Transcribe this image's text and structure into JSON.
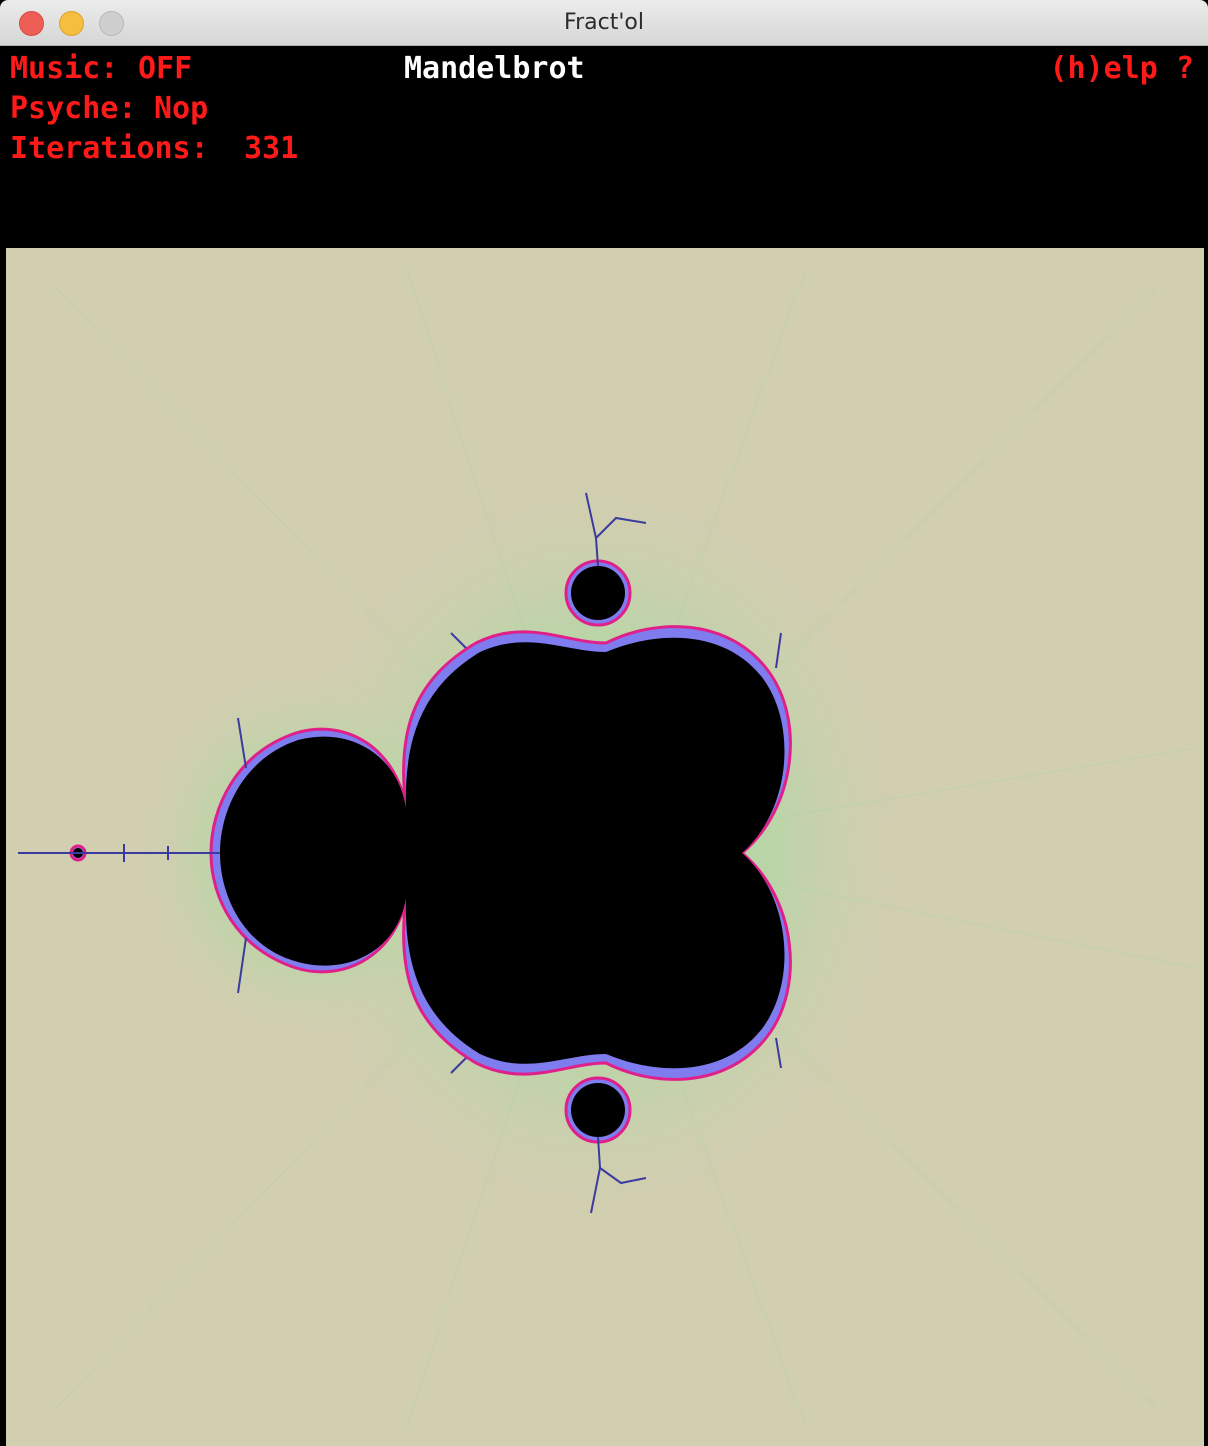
{
  "window": {
    "title": "Fract'ol"
  },
  "hud": {
    "music_label": "Music:",
    "music_value": "OFF",
    "psyche_label": "Psyche:",
    "psyche_value": "Nop",
    "iterations_label": "Iterations:",
    "iterations_value": "331",
    "fractal_name": "Mandelbrot",
    "help": "(h)elp ?"
  },
  "render": {
    "fractal": "Mandelbrot",
    "iterations": 331,
    "colors": {
      "background": "#d2ceb0",
      "set": "#000000",
      "halo_green": "#8fdc9a",
      "edge_blue": "#7f7cf0",
      "edge_magenta": "#e0208a",
      "hud_text": "#ff1a1a",
      "hud_title": "#ffffff"
    }
  }
}
